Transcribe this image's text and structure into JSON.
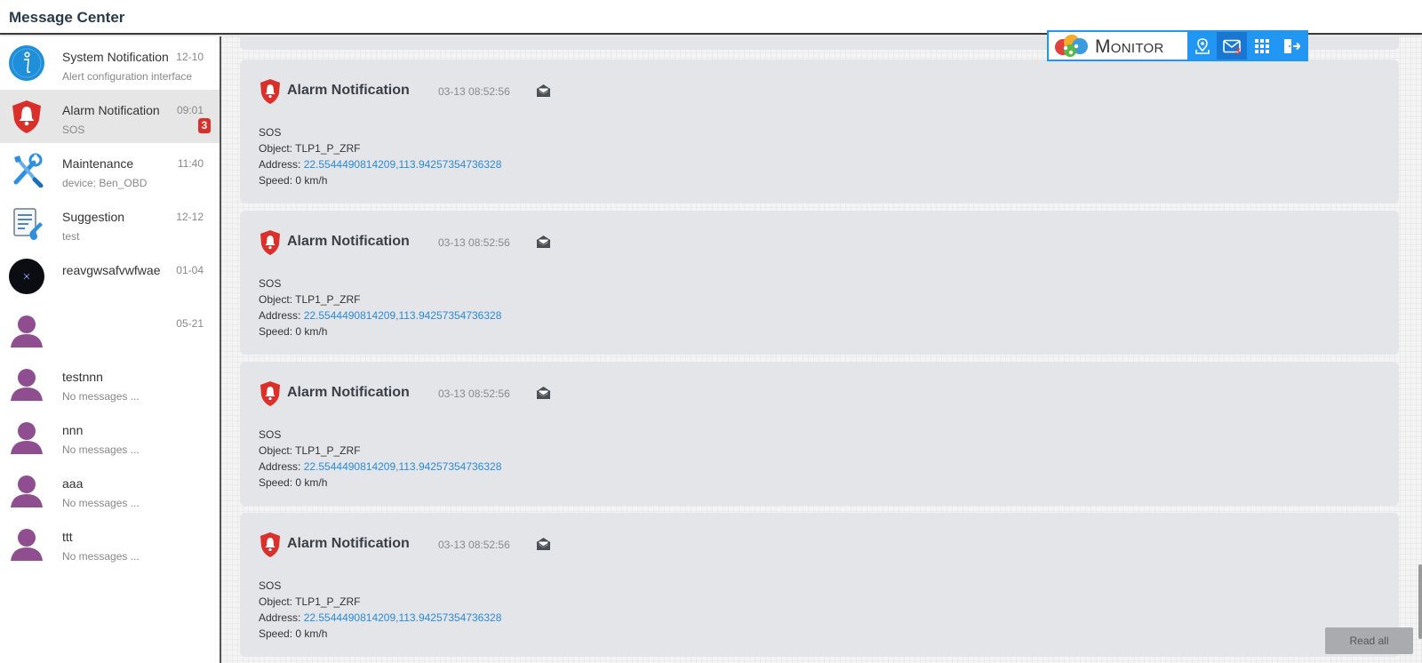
{
  "header": {
    "title": "Message Center"
  },
  "sidebar": {
    "items": [
      {
        "name": "System Notification",
        "sub": "Alert configuration interface",
        "time": "12-10",
        "badge": "",
        "icon": "info-icon"
      },
      {
        "name": "Alarm Notification",
        "sub": "SOS",
        "time": "09:01",
        "badge": "3",
        "icon": "alarm-shield-icon"
      },
      {
        "name": "Maintenance",
        "sub": "device: Ben_OBD",
        "time": "11:40",
        "badge": "",
        "icon": "wrench-tools-icon"
      },
      {
        "name": "Suggestion",
        "sub": "test",
        "time": "12-12",
        "badge": "",
        "icon": "suggestion-form-icon"
      },
      {
        "name": "reavgwsafvwfwae",
        "sub": "",
        "time": "01-04",
        "badge": "",
        "icon": "dark-avatar-icon"
      },
      {
        "name": "",
        "sub": "",
        "time": "05-21",
        "badge": "",
        "icon": "user-avatar-icon"
      },
      {
        "name": "testnnn",
        "sub": "No messages ...",
        "time": "",
        "badge": "",
        "icon": "user-avatar-icon"
      },
      {
        "name": "nnn",
        "sub": "No messages ...",
        "time": "",
        "badge": "",
        "icon": "user-avatar-icon"
      },
      {
        "name": "aaa",
        "sub": "No messages ...",
        "time": "",
        "badge": "",
        "icon": "user-avatar-icon"
      },
      {
        "name": "ttt",
        "sub": "No messages ...",
        "time": "",
        "badge": "",
        "icon": "user-avatar-icon"
      }
    ]
  },
  "messages": [
    {
      "title": "Alarm Notification",
      "time": "03-13 08:52:56",
      "type": "SOS",
      "object_label": "Object:",
      "object": "TLP1_P_ZRF",
      "address_label": "Address:",
      "address": "22.5544490814209,113.94257354736328",
      "speed_label": "Speed:",
      "speed": "0 km/h"
    },
    {
      "title": "Alarm Notification",
      "time": "03-13 08:52:56",
      "type": "SOS",
      "object_label": "Object:",
      "object": "TLP1_P_ZRF",
      "address_label": "Address:",
      "address": "22.5544490814209,113.94257354736328",
      "speed_label": "Speed:",
      "speed": "0 km/h"
    },
    {
      "title": "Alarm Notification",
      "time": "03-13 08:52:56",
      "type": "SOS",
      "object_label": "Object:",
      "object": "TLP1_P_ZRF",
      "address_label": "Address:",
      "address": "22.5544490814209,113.94257354736328",
      "speed_label": "Speed:",
      "speed": "0 km/h"
    },
    {
      "title": "Alarm Notification",
      "time": "03-13 08:52:56",
      "type": "SOS",
      "object_label": "Object:",
      "object": "TLP1_P_ZRF",
      "address_label": "Address:",
      "address": "22.5544490814209,113.94257354736328",
      "speed_label": "Speed:",
      "speed": "0 km/h"
    }
  ],
  "toolbar": {
    "logo_text": "Monitor",
    "buttons": [
      {
        "icon": "map-pin-icon"
      },
      {
        "icon": "mail-icon",
        "badge": "3"
      },
      {
        "icon": "grid-apps-icon"
      },
      {
        "icon": "logout-icon"
      }
    ]
  },
  "footer": {
    "read_all_label": "Read all"
  },
  "colors": {
    "accent": "#2196f3",
    "alarm": "#d9302c",
    "link": "#2a8ad8",
    "card": "#e3e5e8"
  }
}
